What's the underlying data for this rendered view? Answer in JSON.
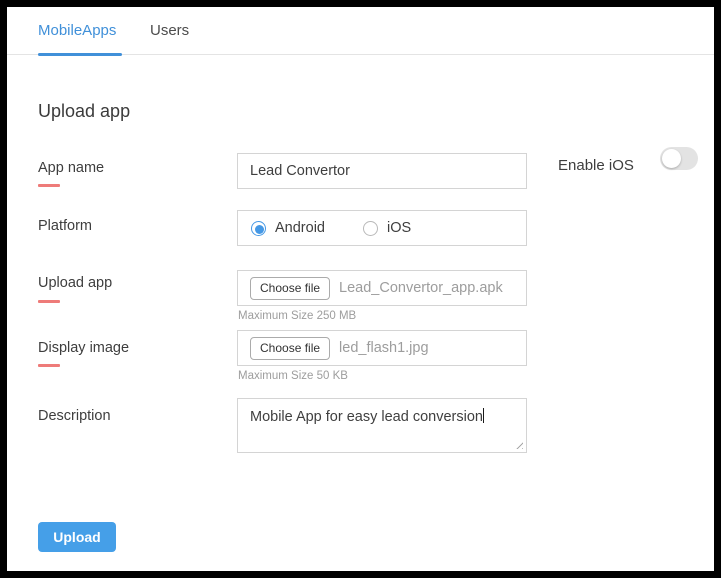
{
  "tabs": {
    "mobileapps": {
      "label": "MobileApps",
      "active": true
    },
    "users": {
      "label": "Users",
      "active": false
    }
  },
  "heading": "Upload app",
  "form": {
    "app_name": {
      "label": "App name",
      "required": true,
      "value": "Lead Convertor"
    },
    "enable_ios": {
      "label": "Enable iOS",
      "state": "off"
    },
    "platform": {
      "label": "Platform",
      "options": [
        {
          "label": "Android",
          "selected": true
        },
        {
          "label": "iOS",
          "selected": false
        }
      ]
    },
    "upload_app": {
      "label": "Upload app",
      "required": true,
      "button": "Choose file",
      "filename": "Lead_Convertor_app.apk",
      "hint": "Maximum Size 250 MB"
    },
    "display_image": {
      "label": "Display image",
      "required": true,
      "button": "Choose file",
      "filename": "led_flash1.jpg",
      "hint": "Maximum Size 50 KB"
    },
    "description": {
      "label": "Description",
      "value": "Mobile App for easy lead conversion"
    }
  },
  "submit": {
    "label": "Upload"
  },
  "colors": {
    "accent_blue": "#4090d9",
    "button_blue": "#459fe8",
    "required_red": "#ee7b79"
  }
}
